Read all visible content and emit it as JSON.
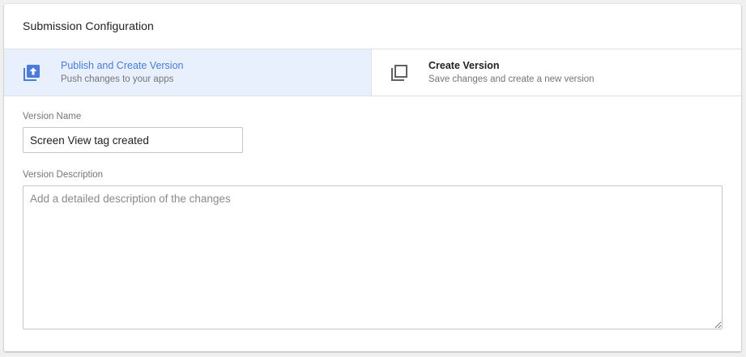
{
  "panel": {
    "title": "Submission Configuration"
  },
  "options": [
    {
      "title": "Publish and Create Version",
      "subtitle": "Push changes to your apps",
      "icon": "publish-icon",
      "selected": true
    },
    {
      "title": "Create Version",
      "subtitle": "Save changes and create a new version",
      "icon": "copy-icon",
      "selected": false
    }
  ],
  "form": {
    "version_name_label": "Version Name",
    "version_name_value": "Screen View tag created",
    "version_description_label": "Version Description",
    "version_description_placeholder": "Add a detailed description of the changes"
  },
  "colors": {
    "accent": "#4a7bd8",
    "selected_bg": "#e8f0fe"
  }
}
